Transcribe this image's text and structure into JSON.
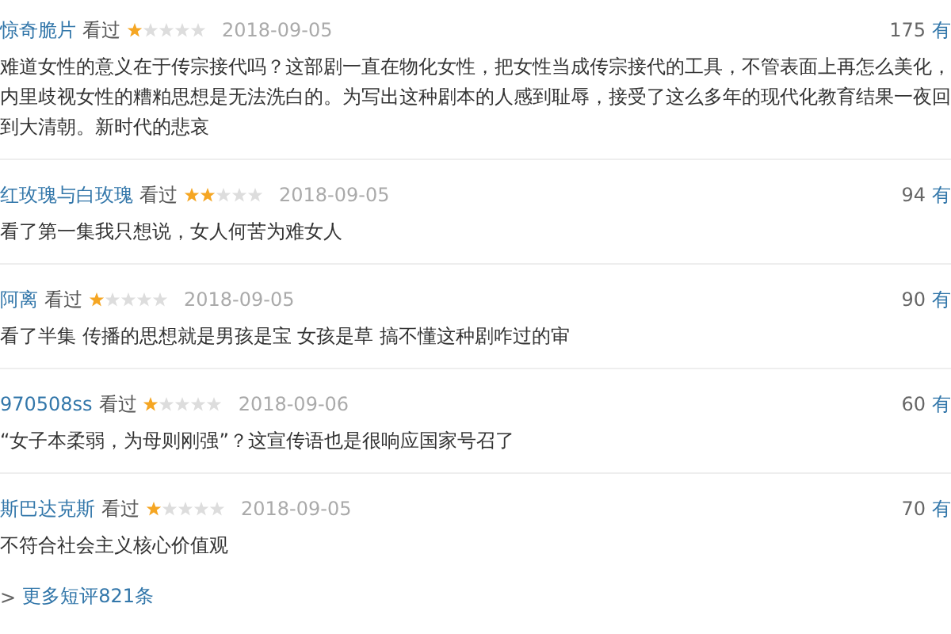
{
  "reviews": [
    {
      "user": "惊奇脆片",
      "status": "看过",
      "stars": 1,
      "date": "2018-09-05",
      "votes": "175",
      "vote_link": "有",
      "text": "难道女性的意义在于传宗接代吗？这部剧一直在物化女性，把女性当成传宗接代的工具，不管表面上再怎么美化，内里歧视女性的糟粕思想是无法洗白的。为写出这种剧本的人感到耻辱，接受了这么多年的现代化教育结果一夜回到大清朝。新时代的悲哀"
    },
    {
      "user": "红玫瑰与白玫瑰",
      "status": "看过",
      "stars": 2,
      "date": "2018-09-05",
      "votes": "94",
      "vote_link": "有",
      "text": "看了第一集我只想说，女人何苦为难女人"
    },
    {
      "user": "阿离",
      "status": "看过",
      "stars": 1,
      "date": "2018-09-05",
      "votes": "90",
      "vote_link": "有",
      "text": "看了半集 传播的思想就是男孩是宝 女孩是草 搞不懂这种剧咋过的审"
    },
    {
      "user": "970508ss",
      "status": "看过",
      "stars": 1,
      "date": "2018-09-06",
      "votes": "60",
      "vote_link": "有",
      "text": "“女子本柔弱，为母则刚强”？这宣传语也是很响应国家号召了"
    },
    {
      "user": "斯巴达克斯",
      "status": "看过",
      "stars": 1,
      "date": "2018-09-05",
      "votes": "70",
      "vote_link": "有",
      "text": "不符合社会主义核心价值观"
    }
  ],
  "more_link": {
    "arrow": ">",
    "label": "更多短评821条"
  }
}
